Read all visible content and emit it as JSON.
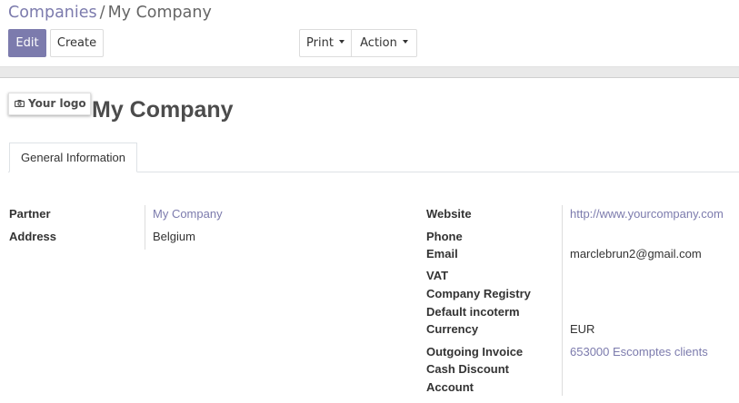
{
  "breadcrumb": {
    "parent": "Companies",
    "separator": "/",
    "current": "My Company"
  },
  "toolbar": {
    "edit_label": "Edit",
    "create_label": "Create",
    "print_label": "Print",
    "action_label": "Action"
  },
  "record": {
    "logo_placeholder": "Your logo",
    "name": "My Company"
  },
  "tabs": [
    {
      "label": "General Information",
      "active": true
    }
  ],
  "left_fields": [
    {
      "label": "Partner",
      "value": "My Company",
      "is_link": true
    },
    {
      "label": "Address",
      "value": "Belgium",
      "is_link": false
    }
  ],
  "right_fields": [
    {
      "label": "Website",
      "value": "http://www.yourcompany.com",
      "is_link": true
    },
    {
      "label": "Phone",
      "value": ""
    },
    {
      "label": "Email",
      "value": "marclebrun2@gmail.com"
    },
    {
      "label": "VAT",
      "value": ""
    },
    {
      "label": "Company Registry",
      "value": ""
    },
    {
      "label": "Default incoterm",
      "value": ""
    },
    {
      "label": "Currency",
      "value": "EUR"
    },
    {
      "label_line1": "Outgoing Invoice",
      "label_line2": "Cash Discount",
      "label_line3": "Account",
      "value": "653000 Escomptes clients",
      "is_link": true
    }
  ],
  "colors": {
    "accent": "#7c7bad",
    "text": "#333333",
    "band": "#e9e9e9"
  },
  "icons": {
    "logo": "camera-icon",
    "dropdown": "caret-down-icon"
  }
}
